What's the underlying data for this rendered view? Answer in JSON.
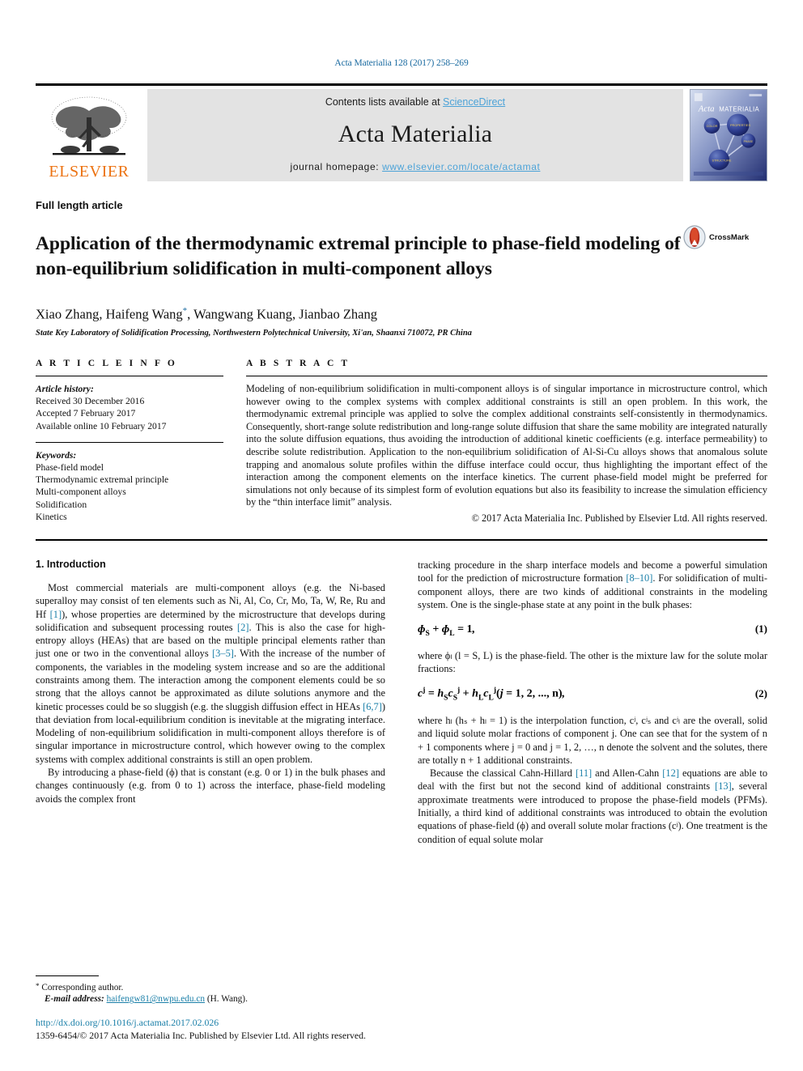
{
  "running_head": "Acta Materialia 128 (2017) 258–269",
  "banner": {
    "publisher_name": "ELSEVIER",
    "contents_prefix": "Contents lists available at ",
    "contents_link": "ScienceDirect",
    "journal_name": "Acta Materialia",
    "homepage_prefix": "journal homepage: ",
    "homepage_url": "www.elsevier.com/locate/actamat",
    "cover_title_italic": "Acta",
    "cover_title_rest": "MATERIALIA"
  },
  "article": {
    "type": "Full length article",
    "title": "Application of the thermodynamic extremal principle to phase-field modeling of non-equilibrium solidification in multi-component alloys",
    "crossmark_label": "CrossMark",
    "authors_part1": "Xiao Zhang, Haifeng Wang",
    "authors_star": "*",
    "authors_part2": ", Wangwang Kuang, Jianbao Zhang",
    "affiliation": "State Key Laboratory of Solidification Processing, Northwestern Polytechnical University, Xi'an, Shaanxi 710072, PR China"
  },
  "article_info": {
    "heading": "A R T I C L E   I N F O",
    "history_label": "Article history:",
    "history": [
      "Received 30 December 2016",
      "Accepted 7 February 2017",
      "Available online 10 February 2017"
    ],
    "keywords_label": "Keywords:",
    "keywords": [
      "Phase-field model",
      "Thermodynamic extremal principle",
      "Multi-component alloys",
      "Solidification",
      "Kinetics"
    ]
  },
  "abstract": {
    "heading": "A B S T R A C T",
    "text": "Modeling of non-equilibrium solidification in multi-component alloys is of singular importance in microstructure control, which however owing to the complex systems with complex additional constraints is still an open problem. In this work, the thermodynamic extremal principle was applied to solve the complex additional constraints self-consistently in thermodynamics. Consequently, short-range solute redistribution and long-range solute diffusion that share the same mobility are integrated naturally into the solute diffusion equations, thus avoiding the introduction of additional kinetic coefficients (e.g. interface permeability) to describe solute redistribution. Application to the non-equilibrium solidification of Al-Si-Cu alloys shows that anomalous solute trapping and anomalous solute profiles within the diffuse interface could occur, thus highlighting the important effect of the interaction among the component elements on the interface kinetics. The current phase-field model might be preferred for simulations not only because of its simplest form of evolution equations but also its feasibility to increase the simulation efficiency by the “thin interface limit” analysis.",
    "copyright": "© 2017 Acta Materialia Inc. Published by Elsevier Ltd. All rights reserved."
  },
  "body": {
    "section_heading": "1. Introduction",
    "left_para_1_a": "Most commercial materials are multi-component alloys (e.g. the Ni-based superalloy may consist of ten elements such as Ni, Al, Co, Cr, Mo, Ta, W, Re, Ru and Hf ",
    "left_para_1_ref1": "[1]",
    "left_para_1_b": "), whose properties are determined by the microstructure that develops during solidification and subsequent processing routes ",
    "left_para_1_ref2": "[2]",
    "left_para_1_c": ". This is also the case for high-entropy alloys (HEAs) that are based on the multiple principal elements rather than just one or two in the conventional alloys ",
    "left_para_1_ref3": "[3–5]",
    "left_para_1_d": ". With the increase of the number of components, the variables in the modeling system increase and so are the additional constraints among them. The interaction among the component elements could be so strong that the alloys cannot be approximated as dilute solutions anymore and the kinetic processes could be so sluggish (e.g. the sluggish diffusion effect in HEAs ",
    "left_para_1_ref4": "[6,7]",
    "left_para_1_e": ") that deviation from local-equilibrium condition is inevitable at the migrating interface. Modeling of non-equilibrium solidification in multi-component alloys therefore is of singular importance in microstructure control, which however owing to the complex systems with complex additional constraints is still an open problem.",
    "left_para_2": "By introducing a phase-field (ϕ) that is constant (e.g. 0 or 1) in the bulk phases and changes continuously (e.g. from 0 to 1) across the interface, phase-field modeling avoids the complex front",
    "right_para_1_a": "tracking procedure in the sharp interface models and become a powerful simulation tool for the prediction of microstructure formation ",
    "right_para_1_ref1": "[8–10]",
    "right_para_1_b": ". For solidification of multi-component alloys, there are two kinds of additional constraints in the modeling system. One is the single-phase state at any point in the bulk phases:",
    "eq1_number": "(1)",
    "right_para_2": "where ϕₗ (l = S, L) is the phase-field. The other is the mixture law for the solute molar fractions:",
    "eq2_number": "(2)",
    "right_para_3": "where hₗ (hₛ + hₗ = 1) is the interpolation function, cʲ, cʲₛ and cʲₗ are the overall, solid and liquid solute molar fractions of component j. One can see that for the system of n + 1 components where j = 0 and j = 1, 2, …, n denote the solvent and the solutes, there are totally n + 1 additional constraints.",
    "right_para_4_a": "Because the classical Cahn-Hillard ",
    "right_para_4_ref1": "[11]",
    "right_para_4_b": " and Allen-Cahn ",
    "right_para_4_ref2": "[12]",
    "right_para_4_c": " equations are able to deal with the first but not the second kind of additional constraints ",
    "right_para_4_ref3": "[13]",
    "right_para_4_d": ", several approximate treatments were introduced to propose the phase-field models (PFMs). Initially, a third kind of additional constraints was introduced to obtain the evolution equations of phase-field (ϕ) and overall solute molar fractions (cʲ). One treatment is the condition of equal solute molar"
  },
  "footnote": {
    "corresponding": "Corresponding author.",
    "email_label": "E-mail address:",
    "email": "haifengw81@nwpu.edu.cn",
    "email_suffix": " (H. Wang)."
  },
  "footer": {
    "doi": "http://dx.doi.org/10.1016/j.actamat.2017.02.026",
    "issn_line": "1359-6454/© 2017 Acta Materialia Inc. Published by Elsevier Ltd. All rights reserved."
  },
  "colors": {
    "link": "#1a7fa8",
    "running_head": "#1a6aa0",
    "elsevier_orange": "#ec7211",
    "banner_bg": "#e3e3e3",
    "sciencedirect": "#4ca3d8"
  }
}
